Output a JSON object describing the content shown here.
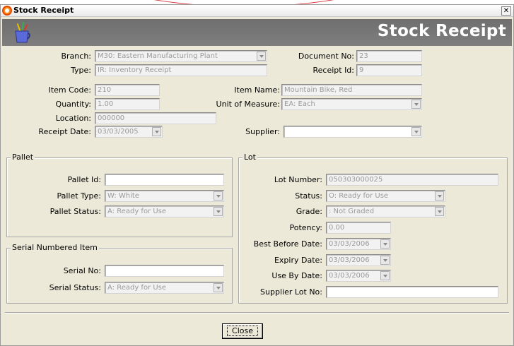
{
  "window": {
    "title": "Stock Receipt",
    "banner_title": "Stock Receipt"
  },
  "header": {
    "branch_label": "Branch:",
    "branch_value": "M30: Eastern Manufacturing Plant",
    "document_no_label": "Document No:",
    "document_no_value": "23",
    "type_label": "Type:",
    "type_value": "IR: Inventory Receipt",
    "receipt_id_label": "Receipt Id:",
    "receipt_id_value": "9",
    "item_code_label": "Item Code:",
    "item_code_value": "210",
    "item_name_label": "Item Name:",
    "item_name_value": "Mountain Bike, Red",
    "quantity_label": "Quantity:",
    "quantity_value": "1.00",
    "uom_label": "Unit of Measure:",
    "uom_value": "EA: Each",
    "location_label": "Location:",
    "location_value": "000000",
    "receipt_date_label": "Receipt Date:",
    "receipt_date_value": "03/03/2005",
    "supplier_label": "Supplier:",
    "supplier_value": ""
  },
  "pallet": {
    "group_label": "Pallet",
    "pallet_id_label": "Pallet Id:",
    "pallet_id_value": "",
    "pallet_type_label": "Pallet Type:",
    "pallet_type_value": "W: White",
    "pallet_status_label": "Pallet Status:",
    "pallet_status_value": "A: Ready for Use"
  },
  "serial": {
    "group_label": "Serial Numbered Item",
    "serial_no_label": "Serial No:",
    "serial_no_value": "",
    "serial_status_label": "Serial Status:",
    "serial_status_value": "A: Ready for Use"
  },
  "lot": {
    "group_label": "Lot",
    "lot_number_label": "Lot Number:",
    "lot_number_value": "050303000025",
    "status_label": "Status:",
    "status_value": "O: Ready for Use",
    "grade_label": "Grade:",
    "grade_value": ": Not Graded",
    "potency_label": "Potency:",
    "potency_value": "0.00",
    "best_before_label": "Best Before Date:",
    "best_before_value": "03/03/2006",
    "expiry_label": "Expiry Date:",
    "expiry_value": "03/03/2006",
    "use_by_label": "Use By Date:",
    "use_by_value": "03/03/2006",
    "supplier_lot_label": "Supplier Lot No:",
    "supplier_lot_value": ""
  },
  "footer": {
    "close_label": "Close"
  },
  "icons": {
    "app": "app-logo-icon",
    "banner": "pencil-cup-icon",
    "close": "close-icon",
    "dropdown": "chevron-down-icon"
  },
  "colors": {
    "banner_bg": "#7a7a7a",
    "window_bg": "#ece9d8",
    "accent_arc": "#d9323c",
    "disabled_text": "#9a9a9a"
  }
}
